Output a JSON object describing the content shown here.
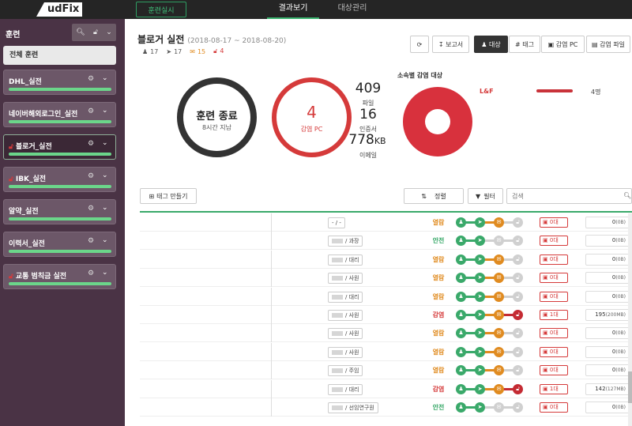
{
  "app": {
    "logo_text": "udFix"
  },
  "nav": {
    "run_button": "훈련실시",
    "tabs": [
      {
        "label": "결과보기",
        "active": true
      },
      {
        "label": "대상관리",
        "active": false
      }
    ]
  },
  "sidebar": {
    "title": "훈련",
    "all_label": "전체 훈련",
    "items": [
      {
        "label": "DHL_실전",
        "locked": false,
        "active": false
      },
      {
        "label": "네이버해외로그인_실전",
        "locked": false,
        "active": false
      },
      {
        "label": "블로거_실전",
        "locked": true,
        "active": true
      },
      {
        "label": "IBK_실전",
        "locked": true,
        "active": false
      },
      {
        "label": "알약_실전",
        "locked": false,
        "active": false
      },
      {
        "label": "이력서_실전",
        "locked": false,
        "active": false
      },
      {
        "label": "교통 범칙금 실전",
        "locked": true,
        "active": false
      }
    ]
  },
  "main": {
    "title": "블로거 실전",
    "date_range": "(2018-08-17 ~ 2018-08-20)",
    "stats": {
      "targets": "17",
      "sent": "17",
      "opened": "15",
      "infected": "4"
    },
    "toolbar": {
      "refresh_icon": "refresh-icon",
      "report": "보고서",
      "by_target": "대상",
      "by_tag": "태그",
      "infected_pc": "감염 PC",
      "infected_file": "감염 파일"
    },
    "summary": {
      "end_title": "훈련 종료",
      "end_sub": "8시간 지남",
      "infected_count": "4",
      "infected_label": "감염 PC",
      "files_num": "409",
      "files_label": "파일",
      "certs_num": "16",
      "certs_label": "인증서",
      "email_num": "778",
      "email_unit": "KB",
      "email_label": "이메일"
    },
    "dept_chart": {
      "title": "소속별 감염 대상",
      "legend": [
        {
          "name": "L&F",
          "value": "4명",
          "color": "#c9333a"
        }
      ]
    },
    "filters": {
      "tag_button": "태그 만들기",
      "sort_button": "정렬",
      "filter_button": "필터",
      "search_placeholder": "검색"
    },
    "rows": [
      {
        "rank": "- / -",
        "status": "열람",
        "status_type": "open",
        "steps": [
          "g",
          "g",
          "o",
          "gr"
        ],
        "pc": "0대",
        "sent_num": "0",
        "sent_unit": "(0B)"
      },
      {
        "rank": "/ 과장",
        "status": "안전",
        "status_type": "safe",
        "steps": [
          "g",
          "g",
          "gr",
          "gr"
        ],
        "pc": "0대",
        "sent_num": "0",
        "sent_unit": "(0B)"
      },
      {
        "rank": "/ 대리",
        "status": "열람",
        "status_type": "open",
        "steps": [
          "g",
          "g",
          "o",
          "gr"
        ],
        "pc": "0대",
        "sent_num": "0",
        "sent_unit": "(0B)"
      },
      {
        "rank": "/ 사원",
        "status": "열람",
        "status_type": "open",
        "steps": [
          "g",
          "g",
          "o",
          "gr"
        ],
        "pc": "0대",
        "sent_num": "0",
        "sent_unit": "(0B)"
      },
      {
        "rank": "/ 대리",
        "status": "열람",
        "status_type": "open",
        "steps": [
          "g",
          "g",
          "o",
          "gr"
        ],
        "pc": "0대",
        "sent_num": "0",
        "sent_unit": "(0B)"
      },
      {
        "rank": "/ 사원",
        "status": "감염",
        "status_type": "infected",
        "steps": [
          "g",
          "g",
          "o",
          "r"
        ],
        "pc": "1대",
        "sent_num": "195",
        "sent_unit": "(200MB)"
      },
      {
        "rank": "/ 사원",
        "status": "열람",
        "status_type": "open",
        "steps": [
          "g",
          "g",
          "o",
          "gr"
        ],
        "pc": "0대",
        "sent_num": "0",
        "sent_unit": "(0B)"
      },
      {
        "rank": "/ 사원",
        "status": "열람",
        "status_type": "open",
        "steps": [
          "g",
          "g",
          "o",
          "gr"
        ],
        "pc": "0대",
        "sent_num": "0",
        "sent_unit": "(0B)"
      },
      {
        "rank": "/ 주임",
        "status": "열람",
        "status_type": "open",
        "steps": [
          "g",
          "g",
          "o",
          "gr"
        ],
        "pc": "0대",
        "sent_num": "0",
        "sent_unit": "(0B)"
      },
      {
        "rank": "/ 대리",
        "status": "감염",
        "status_type": "infected",
        "steps": [
          "g",
          "g",
          "o",
          "r"
        ],
        "pc": "1대",
        "sent_num": "142",
        "sent_unit": "(127MB)"
      },
      {
        "rank": "/ 선임연구원",
        "status": "안전",
        "status_type": "safe",
        "steps": [
          "g",
          "g",
          "gr",
          "gr"
        ],
        "pc": "0대",
        "sent_num": "0",
        "sent_unit": "(0B)"
      }
    ]
  }
}
